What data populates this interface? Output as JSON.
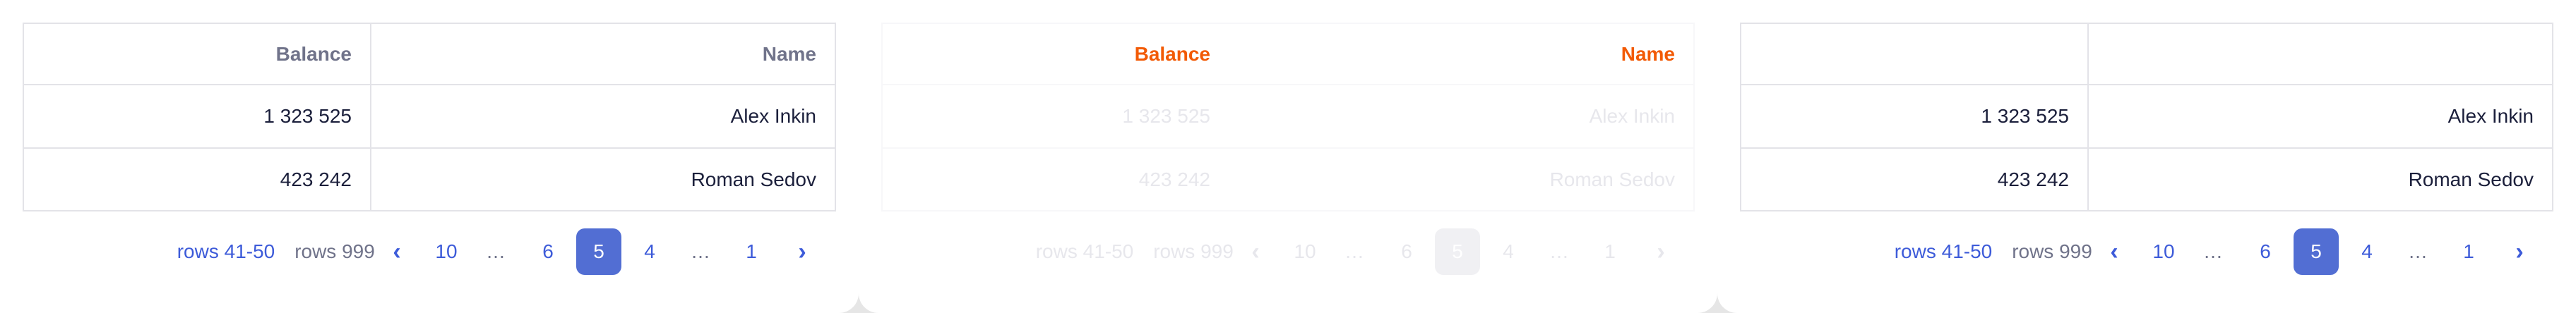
{
  "columns": {
    "balance": "Balance",
    "name": "Name"
  },
  "rows": [
    {
      "balance": "1 323 525",
      "name": "Alex Inkin"
    },
    {
      "balance": "423 242",
      "name": "Roman Sedov"
    }
  ],
  "pagination": {
    "range_label": "rows 41-50",
    "size_label": "rows 999",
    "prev_icon": "chevron-left-icon",
    "next_icon": "chevron-right-icon",
    "prev_glyph": "‹",
    "next_glyph": "›",
    "pages": [
      "10",
      "…",
      "6",
      "5",
      "4",
      "…",
      "1"
    ],
    "active_page": "5"
  },
  "colors": {
    "accent": "#526ed3",
    "link": "#3d5bd9",
    "header_text": "#70738a",
    "header_text_highlight": "#f25a05",
    "border": "#e3e3e8"
  }
}
